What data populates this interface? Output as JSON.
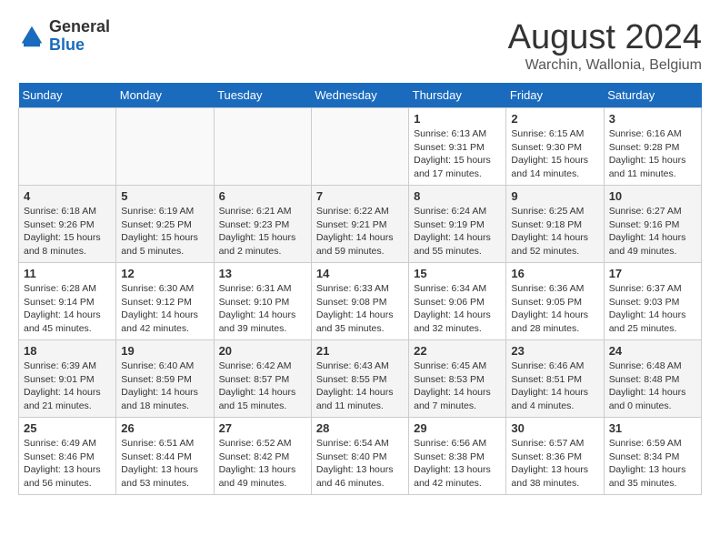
{
  "header": {
    "logo_general": "General",
    "logo_blue": "Blue",
    "month_year": "August 2024",
    "location": "Warchin, Wallonia, Belgium"
  },
  "days_of_week": [
    "Sunday",
    "Monday",
    "Tuesday",
    "Wednesday",
    "Thursday",
    "Friday",
    "Saturday"
  ],
  "weeks": [
    [
      {
        "day": "",
        "info": ""
      },
      {
        "day": "",
        "info": ""
      },
      {
        "day": "",
        "info": ""
      },
      {
        "day": "",
        "info": ""
      },
      {
        "day": "1",
        "info": "Sunrise: 6:13 AM\nSunset: 9:31 PM\nDaylight: 15 hours\nand 17 minutes."
      },
      {
        "day": "2",
        "info": "Sunrise: 6:15 AM\nSunset: 9:30 PM\nDaylight: 15 hours\nand 14 minutes."
      },
      {
        "day": "3",
        "info": "Sunrise: 6:16 AM\nSunset: 9:28 PM\nDaylight: 15 hours\nand 11 minutes."
      }
    ],
    [
      {
        "day": "4",
        "info": "Sunrise: 6:18 AM\nSunset: 9:26 PM\nDaylight: 15 hours\nand 8 minutes."
      },
      {
        "day": "5",
        "info": "Sunrise: 6:19 AM\nSunset: 9:25 PM\nDaylight: 15 hours\nand 5 minutes."
      },
      {
        "day": "6",
        "info": "Sunrise: 6:21 AM\nSunset: 9:23 PM\nDaylight: 15 hours\nand 2 minutes."
      },
      {
        "day": "7",
        "info": "Sunrise: 6:22 AM\nSunset: 9:21 PM\nDaylight: 14 hours\nand 59 minutes."
      },
      {
        "day": "8",
        "info": "Sunrise: 6:24 AM\nSunset: 9:19 PM\nDaylight: 14 hours\nand 55 minutes."
      },
      {
        "day": "9",
        "info": "Sunrise: 6:25 AM\nSunset: 9:18 PM\nDaylight: 14 hours\nand 52 minutes."
      },
      {
        "day": "10",
        "info": "Sunrise: 6:27 AM\nSunset: 9:16 PM\nDaylight: 14 hours\nand 49 minutes."
      }
    ],
    [
      {
        "day": "11",
        "info": "Sunrise: 6:28 AM\nSunset: 9:14 PM\nDaylight: 14 hours\nand 45 minutes."
      },
      {
        "day": "12",
        "info": "Sunrise: 6:30 AM\nSunset: 9:12 PM\nDaylight: 14 hours\nand 42 minutes."
      },
      {
        "day": "13",
        "info": "Sunrise: 6:31 AM\nSunset: 9:10 PM\nDaylight: 14 hours\nand 39 minutes."
      },
      {
        "day": "14",
        "info": "Sunrise: 6:33 AM\nSunset: 9:08 PM\nDaylight: 14 hours\nand 35 minutes."
      },
      {
        "day": "15",
        "info": "Sunrise: 6:34 AM\nSunset: 9:06 PM\nDaylight: 14 hours\nand 32 minutes."
      },
      {
        "day": "16",
        "info": "Sunrise: 6:36 AM\nSunset: 9:05 PM\nDaylight: 14 hours\nand 28 minutes."
      },
      {
        "day": "17",
        "info": "Sunrise: 6:37 AM\nSunset: 9:03 PM\nDaylight: 14 hours\nand 25 minutes."
      }
    ],
    [
      {
        "day": "18",
        "info": "Sunrise: 6:39 AM\nSunset: 9:01 PM\nDaylight: 14 hours\nand 21 minutes."
      },
      {
        "day": "19",
        "info": "Sunrise: 6:40 AM\nSunset: 8:59 PM\nDaylight: 14 hours\nand 18 minutes."
      },
      {
        "day": "20",
        "info": "Sunrise: 6:42 AM\nSunset: 8:57 PM\nDaylight: 14 hours\nand 15 minutes."
      },
      {
        "day": "21",
        "info": "Sunrise: 6:43 AM\nSunset: 8:55 PM\nDaylight: 14 hours\nand 11 minutes."
      },
      {
        "day": "22",
        "info": "Sunrise: 6:45 AM\nSunset: 8:53 PM\nDaylight: 14 hours\nand 7 minutes."
      },
      {
        "day": "23",
        "info": "Sunrise: 6:46 AM\nSunset: 8:51 PM\nDaylight: 14 hours\nand 4 minutes."
      },
      {
        "day": "24",
        "info": "Sunrise: 6:48 AM\nSunset: 8:48 PM\nDaylight: 14 hours\nand 0 minutes."
      }
    ],
    [
      {
        "day": "25",
        "info": "Sunrise: 6:49 AM\nSunset: 8:46 PM\nDaylight: 13 hours\nand 56 minutes."
      },
      {
        "day": "26",
        "info": "Sunrise: 6:51 AM\nSunset: 8:44 PM\nDaylight: 13 hours\nand 53 minutes."
      },
      {
        "day": "27",
        "info": "Sunrise: 6:52 AM\nSunset: 8:42 PM\nDaylight: 13 hours\nand 49 minutes."
      },
      {
        "day": "28",
        "info": "Sunrise: 6:54 AM\nSunset: 8:40 PM\nDaylight: 13 hours\nand 46 minutes."
      },
      {
        "day": "29",
        "info": "Sunrise: 6:56 AM\nSunset: 8:38 PM\nDaylight: 13 hours\nand 42 minutes."
      },
      {
        "day": "30",
        "info": "Sunrise: 6:57 AM\nSunset: 8:36 PM\nDaylight: 13 hours\nand 38 minutes."
      },
      {
        "day": "31",
        "info": "Sunrise: 6:59 AM\nSunset: 8:34 PM\nDaylight: 13 hours\nand 35 minutes."
      }
    ]
  ]
}
